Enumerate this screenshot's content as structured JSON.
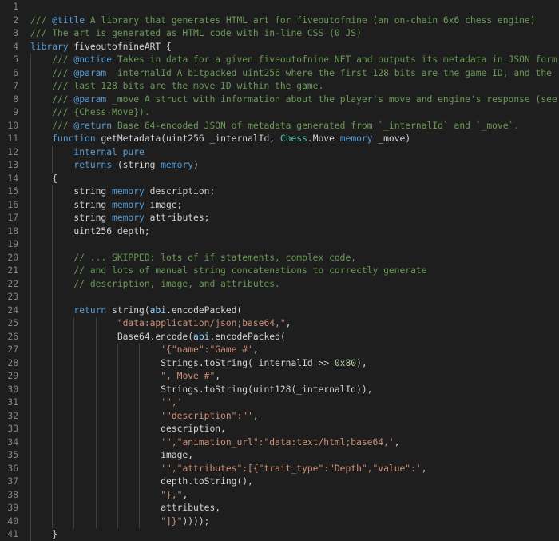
{
  "editor": {
    "language": "solidity",
    "theme": "dark",
    "lines": [
      {
        "n": "1",
        "indent": 0,
        "tokens": []
      },
      {
        "n": "2",
        "indent": 0,
        "tokens": [
          {
            "t": "/// ",
            "c": "comment"
          },
          {
            "t": "@title",
            "c": "tag"
          },
          {
            "t": " A library that generates HTML art for fiveoutofnine (an on-chain 6x6 chess engine)",
            "c": "comment"
          }
        ]
      },
      {
        "n": "3",
        "indent": 0,
        "tokens": [
          {
            "t": "/// The art is generated as HTML code with in-line CSS (0 JS)",
            "c": "comment"
          }
        ]
      },
      {
        "n": "4",
        "indent": 0,
        "tokens": [
          {
            "t": "library",
            "c": "kw"
          },
          {
            "t": " fiveoutofnineART {",
            "c": "plain"
          }
        ]
      },
      {
        "n": "5",
        "indent": 1,
        "tokens": [
          {
            "t": "    /// ",
            "c": "comment"
          },
          {
            "t": "@notice",
            "c": "tag"
          },
          {
            "t": " Takes in data for a given fiveoutofnine NFT and outputs its metadata in JSON form.",
            "c": "comment"
          }
        ]
      },
      {
        "n": "6",
        "indent": 1,
        "tokens": [
          {
            "t": "    /// ",
            "c": "comment"
          },
          {
            "t": "@param",
            "c": "tag"
          },
          {
            "t": " _internalId A bitpacked uint256 where the first 128 bits are the game ID, and the",
            "c": "comment"
          }
        ]
      },
      {
        "n": "7",
        "indent": 1,
        "tokens": [
          {
            "t": "    /// last 128 bits are the move ID within the game.",
            "c": "comment"
          }
        ]
      },
      {
        "n": "8",
        "indent": 1,
        "tokens": [
          {
            "t": "    /// ",
            "c": "comment"
          },
          {
            "t": "@param",
            "c": "tag"
          },
          {
            "t": " _move A struct with information about the player's move and engine's response (see",
            "c": "comment"
          }
        ]
      },
      {
        "n": "9",
        "indent": 1,
        "tokens": [
          {
            "t": "    /// {Chess-Move}).",
            "c": "comment"
          }
        ]
      },
      {
        "n": "10",
        "indent": 1,
        "tokens": [
          {
            "t": "    /// ",
            "c": "comment"
          },
          {
            "t": "@return",
            "c": "tag"
          },
          {
            "t": " Base 64-encoded JSON of metadata generated from `_internalId` and `_move`.",
            "c": "comment"
          }
        ]
      },
      {
        "n": "11",
        "indent": 1,
        "tokens": [
          {
            "t": "    ",
            "c": "plain"
          },
          {
            "t": "function",
            "c": "kw"
          },
          {
            "t": " getMetadata(uint256 _internalId, ",
            "c": "plain"
          },
          {
            "t": "Chess",
            "c": "type"
          },
          {
            "t": ".Move ",
            "c": "plain"
          },
          {
            "t": "memory",
            "c": "kw"
          },
          {
            "t": " _move)",
            "c": "plain"
          }
        ]
      },
      {
        "n": "12",
        "indent": 2,
        "tokens": [
          {
            "t": "        ",
            "c": "plain"
          },
          {
            "t": "internal pure",
            "c": "kw"
          }
        ]
      },
      {
        "n": "13",
        "indent": 2,
        "tokens": [
          {
            "t": "        ",
            "c": "plain"
          },
          {
            "t": "returns",
            "c": "kw"
          },
          {
            "t": " (string ",
            "c": "plain"
          },
          {
            "t": "memory",
            "c": "kw"
          },
          {
            "t": ")",
            "c": "plain"
          }
        ]
      },
      {
        "n": "14",
        "indent": 1,
        "tokens": [
          {
            "t": "    {",
            "c": "plain"
          }
        ]
      },
      {
        "n": "15",
        "indent": 2,
        "tokens": [
          {
            "t": "        string ",
            "c": "plain"
          },
          {
            "t": "memory",
            "c": "kw"
          },
          {
            "t": " description;",
            "c": "plain"
          }
        ]
      },
      {
        "n": "16",
        "indent": 2,
        "tokens": [
          {
            "t": "        string ",
            "c": "plain"
          },
          {
            "t": "memory",
            "c": "kw"
          },
          {
            "t": " image;",
            "c": "plain"
          }
        ]
      },
      {
        "n": "17",
        "indent": 2,
        "tokens": [
          {
            "t": "        string ",
            "c": "plain"
          },
          {
            "t": "memory",
            "c": "kw"
          },
          {
            "t": " attributes;",
            "c": "plain"
          }
        ]
      },
      {
        "n": "18",
        "indent": 2,
        "tokens": [
          {
            "t": "        uint256 depth;",
            "c": "plain"
          }
        ]
      },
      {
        "n": "19",
        "indent": 2,
        "tokens": []
      },
      {
        "n": "20",
        "indent": 2,
        "tokens": [
          {
            "t": "        // ... SKIPPED: lots of if statements, complex code,",
            "c": "comment"
          }
        ]
      },
      {
        "n": "21",
        "indent": 2,
        "tokens": [
          {
            "t": "        // and lots of manual string concatenations to correctly generate",
            "c": "comment"
          }
        ]
      },
      {
        "n": "22",
        "indent": 2,
        "tokens": [
          {
            "t": "        // description, image, and attributes.",
            "c": "comment"
          }
        ]
      },
      {
        "n": "23",
        "indent": 2,
        "tokens": []
      },
      {
        "n": "24",
        "indent": 2,
        "tokens": [
          {
            "t": "        ",
            "c": "plain"
          },
          {
            "t": "return",
            "c": "kw"
          },
          {
            "t": " string(",
            "c": "plain"
          },
          {
            "t": "abi",
            "c": "var"
          },
          {
            "t": ".encodePacked(",
            "c": "plain"
          }
        ]
      },
      {
        "n": "25",
        "indent": 4,
        "tokens": [
          {
            "t": "                ",
            "c": "plain"
          },
          {
            "t": "\"data:application/json;base64,\"",
            "c": "str"
          },
          {
            "t": ",",
            "c": "plain"
          }
        ]
      },
      {
        "n": "26",
        "indent": 4,
        "tokens": [
          {
            "t": "                Base64.encode(",
            "c": "plain"
          },
          {
            "t": "abi",
            "c": "var"
          },
          {
            "t": ".encodePacked(",
            "c": "plain"
          }
        ]
      },
      {
        "n": "27",
        "indent": 6,
        "tokens": [
          {
            "t": "                        ",
            "c": "plain"
          },
          {
            "t": "'{\"name\":\"Game #'",
            "c": "str"
          },
          {
            "t": ",",
            "c": "plain"
          }
        ]
      },
      {
        "n": "28",
        "indent": 6,
        "tokens": [
          {
            "t": "                        Strings.toString(_internalId >> ",
            "c": "plain"
          },
          {
            "t": "0x80",
            "c": "num"
          },
          {
            "t": "),",
            "c": "plain"
          }
        ]
      },
      {
        "n": "29",
        "indent": 6,
        "tokens": [
          {
            "t": "                        ",
            "c": "plain"
          },
          {
            "t": "\", Move #\"",
            "c": "str"
          },
          {
            "t": ",",
            "c": "plain"
          }
        ]
      },
      {
        "n": "30",
        "indent": 6,
        "tokens": [
          {
            "t": "                        Strings.toString(uint128(_internalId)),",
            "c": "plain"
          }
        ]
      },
      {
        "n": "31",
        "indent": 6,
        "tokens": [
          {
            "t": "                        ",
            "c": "plain"
          },
          {
            "t": "'\",'",
            "c": "str"
          }
        ]
      },
      {
        "n": "32",
        "indent": 6,
        "tokens": [
          {
            "t": "                        ",
            "c": "plain"
          },
          {
            "t": "'\"description\":\"'",
            "c": "str"
          },
          {
            "t": ",",
            "c": "plain"
          }
        ]
      },
      {
        "n": "33",
        "indent": 6,
        "tokens": [
          {
            "t": "                        description,",
            "c": "plain"
          }
        ]
      },
      {
        "n": "34",
        "indent": 6,
        "tokens": [
          {
            "t": "                        ",
            "c": "plain"
          },
          {
            "t": "'\",\"animation_url\":\"data:text/html;base64,'",
            "c": "str"
          },
          {
            "t": ",",
            "c": "plain"
          }
        ]
      },
      {
        "n": "35",
        "indent": 6,
        "tokens": [
          {
            "t": "                        image,",
            "c": "plain"
          }
        ]
      },
      {
        "n": "36",
        "indent": 6,
        "tokens": [
          {
            "t": "                        ",
            "c": "plain"
          },
          {
            "t": "'\",\"attributes\":[{\"trait_type\":\"Depth\",\"value\":'",
            "c": "str"
          },
          {
            "t": ",",
            "c": "plain"
          }
        ]
      },
      {
        "n": "37",
        "indent": 6,
        "tokens": [
          {
            "t": "                        depth.toString(),",
            "c": "plain"
          }
        ]
      },
      {
        "n": "38",
        "indent": 6,
        "tokens": [
          {
            "t": "                        ",
            "c": "plain"
          },
          {
            "t": "\"},\"",
            "c": "str"
          },
          {
            "t": ",",
            "c": "plain"
          }
        ]
      },
      {
        "n": "39",
        "indent": 6,
        "tokens": [
          {
            "t": "                        attributes,",
            "c": "plain"
          }
        ]
      },
      {
        "n": "40",
        "indent": 6,
        "tokens": [
          {
            "t": "                        ",
            "c": "plain"
          },
          {
            "t": "\"]}\"",
            "c": "str"
          },
          {
            "t": "))));",
            "c": "plain"
          }
        ]
      },
      {
        "n": "41",
        "indent": 1,
        "tokens": [
          {
            "t": "    }",
            "c": "plain"
          }
        ]
      }
    ]
  }
}
